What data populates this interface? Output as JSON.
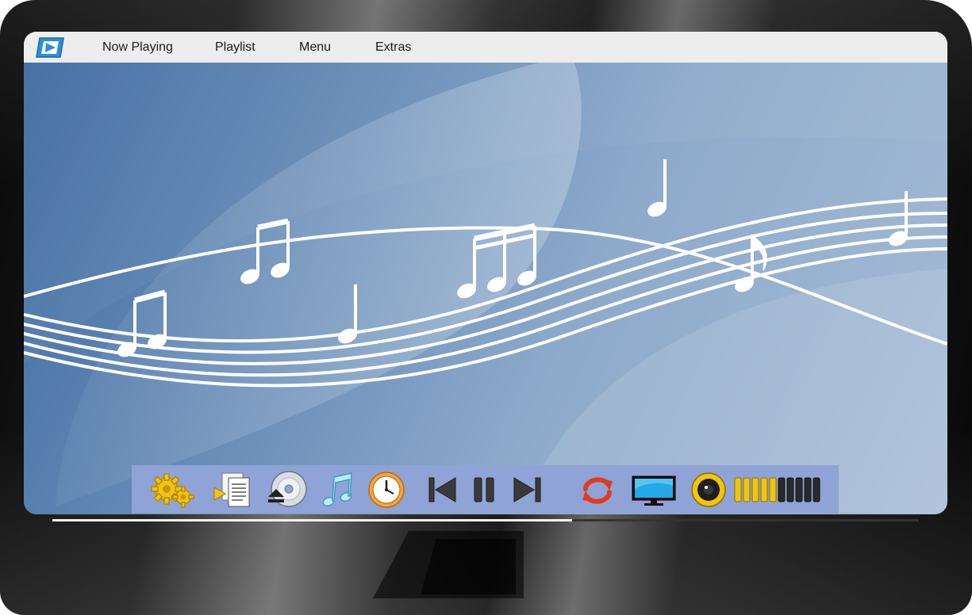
{
  "menubar": {
    "items": [
      {
        "label": "Now Playing"
      },
      {
        "label": "Playlist"
      },
      {
        "label": "Menu"
      },
      {
        "label": "Extras"
      }
    ]
  },
  "toolbar": {
    "icons": [
      "settings-gears-icon",
      "playlist-documents-icon",
      "eject-disc-icon",
      "music-note-icon",
      "clock-icon",
      "previous-track-icon",
      "pause-icon",
      "next-track-icon",
      "repeat-icon",
      "display-monitor-icon",
      "speaker-icon"
    ],
    "volume_level": 0.5
  },
  "playback": {
    "progress": 0.6
  },
  "colors": {
    "accent": "#2f8fd9",
    "toolbar": "#8fa3d6",
    "volume_on": "#f2c40c",
    "volume_off": "#2a2a2a"
  }
}
